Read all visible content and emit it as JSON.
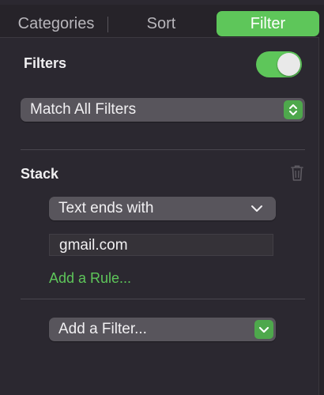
{
  "tabs": {
    "categories": "Categories",
    "sort": "Sort",
    "filter": "Filter",
    "active": "filter"
  },
  "filters": {
    "title": "Filters",
    "enabled": true,
    "match_mode": "Match All Filters"
  },
  "stack": {
    "title": "Stack",
    "rule": {
      "condition": "Text ends with",
      "value": "gmail.com"
    },
    "add_rule_label": "Add a Rule..."
  },
  "add_filter": {
    "label": "Add a Filter..."
  },
  "colors": {
    "accent": "#5ec65a",
    "panel_bg": "#2b2830",
    "control_bg": "#58555c"
  },
  "icons": {
    "trash": "trash-icon",
    "stepper": "up-down-chevron-icon",
    "dropdown": "chevron-down-icon"
  }
}
